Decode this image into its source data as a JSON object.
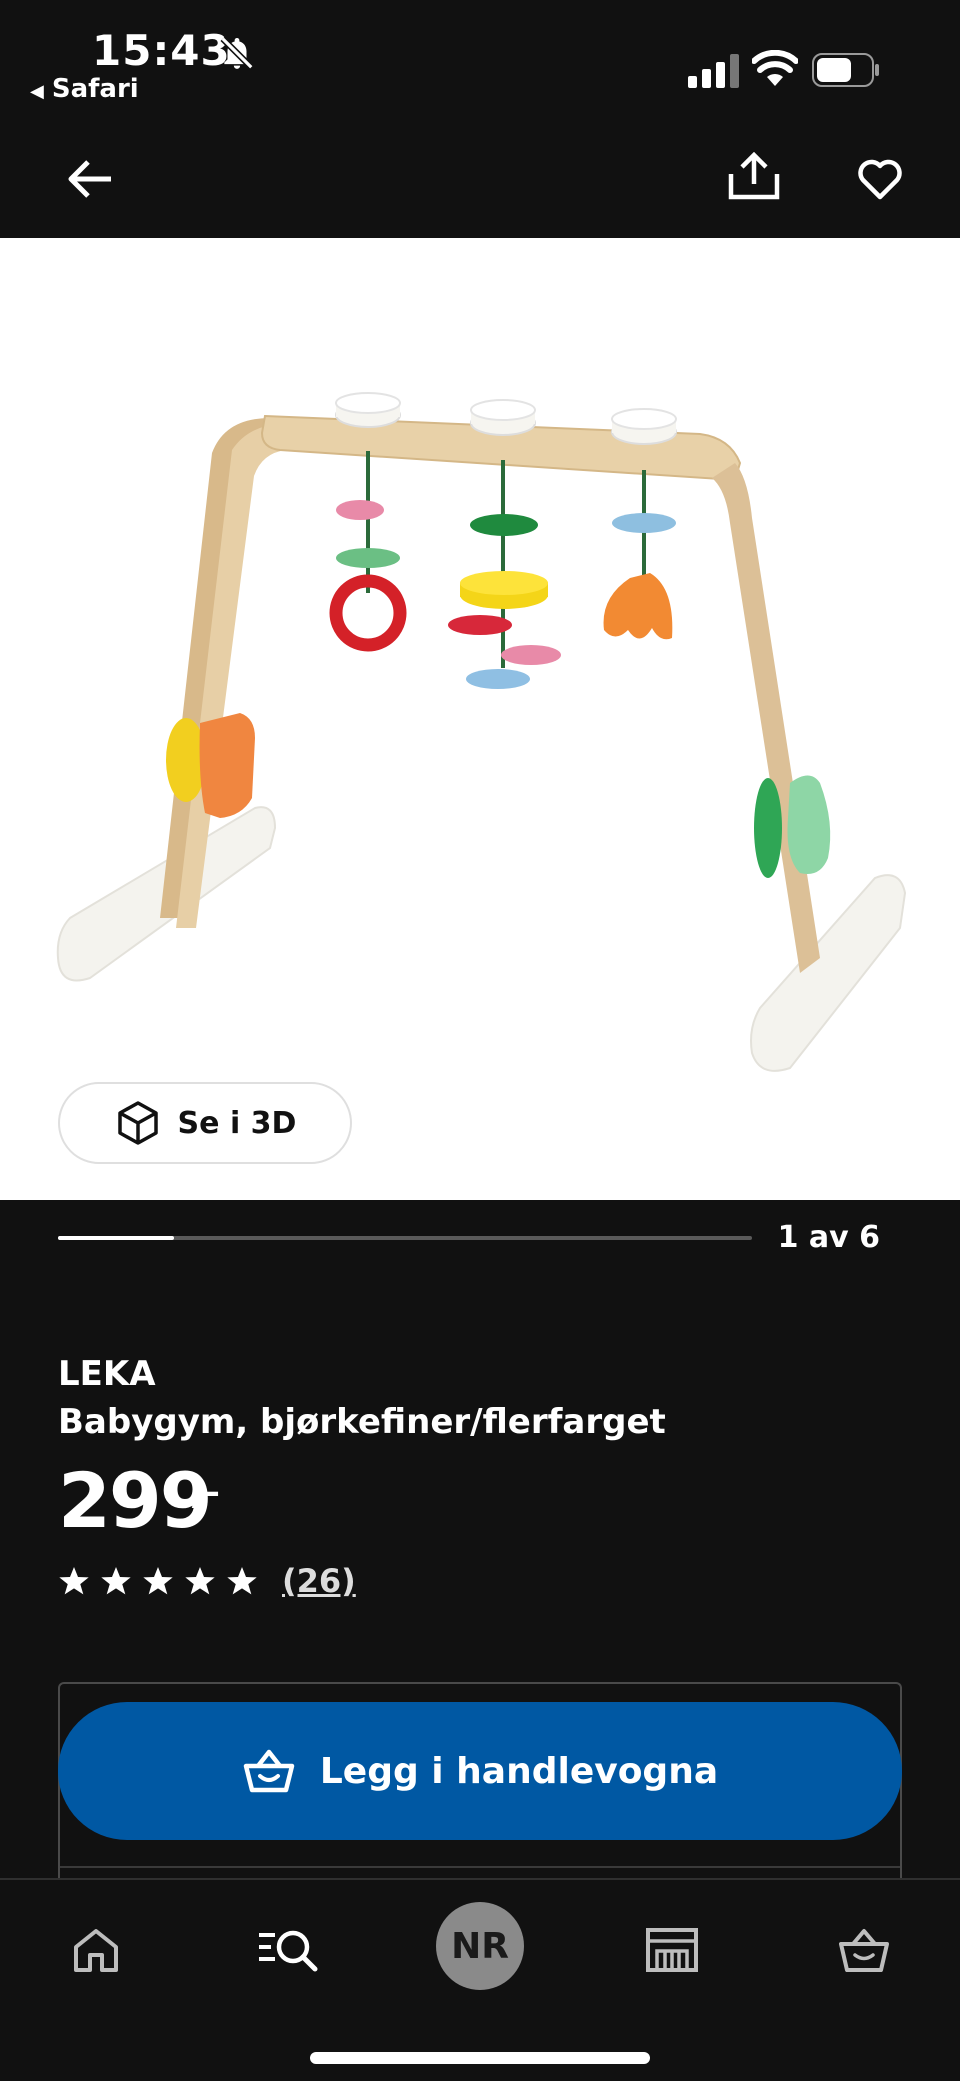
{
  "status_bar": {
    "time": "15:43",
    "back_app": "Safari",
    "icons": [
      "bell-off-icon",
      "signal-icon",
      "wifi-icon",
      "battery-icon"
    ]
  },
  "header": {
    "icons": [
      "arrow-left-icon",
      "share-icon",
      "heart-icon"
    ]
  },
  "gallery": {
    "view_3d_label": "Se i 3D",
    "counter": "1 av 6",
    "current_image": 1,
    "total_images": 6,
    "progress_fraction": 0.167
  },
  "product": {
    "brand": "LEKA",
    "description": "Babygym, bjørkefiner/flerfarget",
    "price": "299",
    "price_suffix": ",–",
    "rating_stars": 5,
    "review_count": "(26)"
  },
  "purchase": {
    "add_to_cart_label": "Legg i handlevogna"
  },
  "bottom_nav": {
    "profile_initials": "NR",
    "items": [
      "home-icon",
      "search-icon",
      "profile-avatar",
      "store-icon",
      "cart-icon"
    ]
  },
  "colors": {
    "background": "#111111",
    "accent_blue": "#0058a3",
    "image_bg": "#ffffff"
  }
}
